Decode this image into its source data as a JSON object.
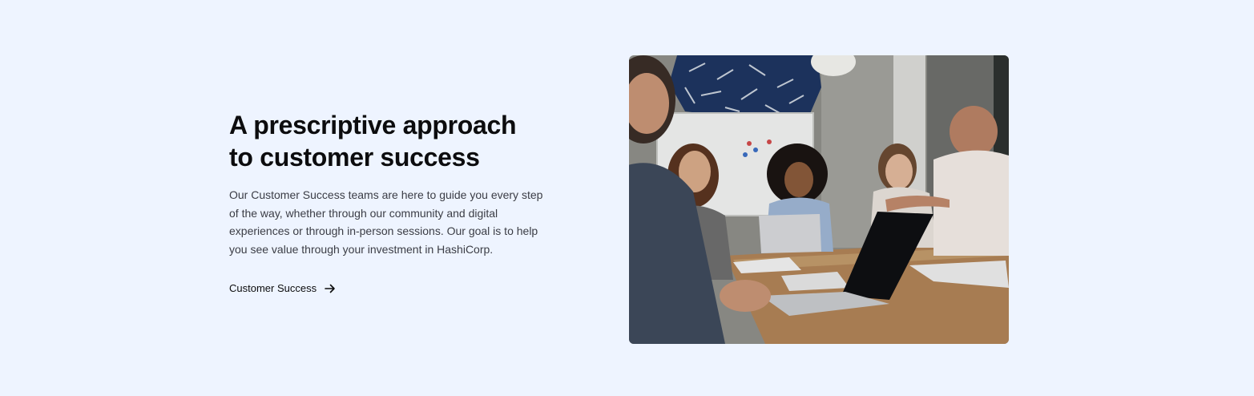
{
  "section": {
    "headline_line1": "A prescriptive approach",
    "headline_line2": "to customer success",
    "body": "Our Customer Success teams are here to guide you every step of the way, whether through our community and digital experiences or through in-person sessions. Our goal is to help you see value through your investment in HashiCorp.",
    "link_label": "Customer Success",
    "link_icon": "arrow-right-icon"
  },
  "image": {
    "alt": "Team meeting around a conference table with laptops"
  },
  "colors": {
    "background": "#eef4ff",
    "headline": "#0c0c0e",
    "body": "#3b3d45"
  }
}
